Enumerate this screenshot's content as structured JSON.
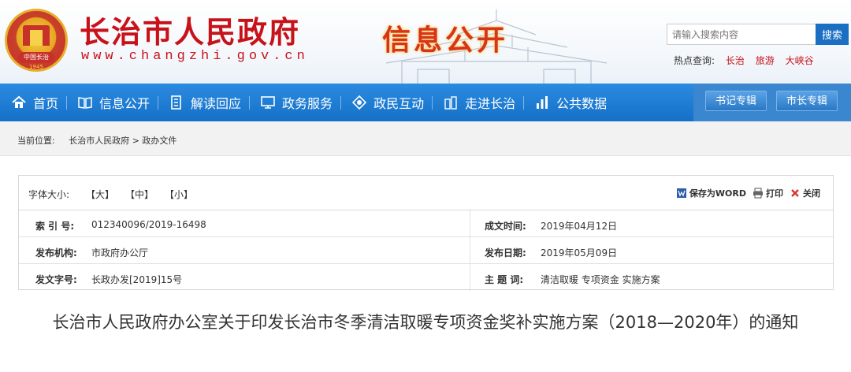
{
  "header": {
    "site_title": "长治市人民政府",
    "site_url": "www.changzhi.gov.cn",
    "section_title": "信息公开",
    "emblem_text": "中国长治",
    "emblem_year": "1945",
    "search": {
      "placeholder": "请输入搜索内容",
      "button": "搜索"
    },
    "hot_search": {
      "label": "热点查询:",
      "links": [
        "长治",
        "旅游",
        "大峡谷"
      ]
    }
  },
  "nav": {
    "items": [
      {
        "label": "首页",
        "icon": "home-icon"
      },
      {
        "label": "信息公开",
        "icon": "book-icon"
      },
      {
        "label": "解读回应",
        "icon": "document-icon"
      },
      {
        "label": "政务服务",
        "icon": "monitor-icon"
      },
      {
        "label": "政民互动",
        "icon": "interaction-icon"
      },
      {
        "label": "走进长治",
        "icon": "city-icon"
      },
      {
        "label": "公共数据",
        "icon": "bar-chart-icon"
      }
    ],
    "special": [
      "书记专辑",
      "市长专辑"
    ]
  },
  "breadcrumb": {
    "label": "当前位置:",
    "items": [
      "长治市人民政府",
      "政办文件"
    ],
    "separator": ">"
  },
  "info": {
    "font_size_label": "字体大小:",
    "font_options": [
      "【大】",
      "【中】",
      "【小】"
    ],
    "tools": {
      "save_word": "保存为WORD",
      "print": "打印",
      "close": "关闭"
    },
    "rows": [
      {
        "left_label": "索 引 号:",
        "left_value": "012340096/2019-16498",
        "right_label": "成文时间:",
        "right_value": "2019年04月12日"
      },
      {
        "left_label": "发布机构:",
        "left_value": "市政府办公厅",
        "right_label": "发布日期:",
        "right_value": "2019年05月09日"
      },
      {
        "left_label": "发文字号:",
        "left_value": "长政办发[2019]15号",
        "right_label": "主 题 词:",
        "right_value": "清洁取暖 专项资金 实施方案"
      }
    ]
  },
  "article": {
    "title": "长治市人民政府办公室关于印发长治市冬季清洁取暖专项资金奖补实施方案（2018—2020年）的通知"
  },
  "colors": {
    "brand_red": "#c8121a",
    "nav_blue": "#1570c8",
    "search_blue": "#1b6fc2"
  }
}
